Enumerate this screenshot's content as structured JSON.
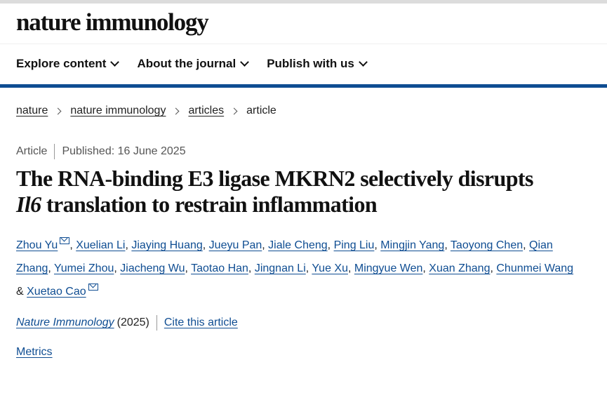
{
  "header": {
    "brand": "nature immunology"
  },
  "nav": {
    "items": [
      {
        "label": "Explore content"
      },
      {
        "label": "About the journal"
      },
      {
        "label": "Publish with us"
      }
    ]
  },
  "breadcrumb": {
    "items": [
      "nature",
      "nature immunology",
      "articles"
    ],
    "current": "article"
  },
  "article": {
    "type": "Article",
    "published": "Published: 16 June 2025",
    "title_part1": "The RNA-binding E3 ligase MKRN2 selectively disrupts",
    "title_italic": "Il6",
    "title_part2": "translation to restrain inflammation",
    "authors": [
      "Zhou Yu",
      "Xuelian Li",
      "Jiaying Huang",
      "Jueyu Pan",
      "Jiale Cheng",
      "Ping Liu",
      "Mingjin Yang",
      "Taoyong Chen",
      "Qian Zhang",
      "Yumei Zhou",
      "Jiacheng Wu",
      "Taotao Han",
      "Jingnan Li",
      "Yue Xu",
      "Mingyue Wen",
      "Xuan Zhang",
      "Chunmei Wang",
      "Xuetao Cao"
    ],
    "author_sep": ", ",
    "author_last_sep": " & ",
    "journal": "Nature Immunology",
    "year": "(2025)",
    "cite_label": "Cite this article",
    "metrics_label": "Metrics"
  },
  "colors": {
    "accent": "#0f4d92",
    "text": "#222222"
  },
  "icons": {
    "nav_chevron": "chevron-down-icon",
    "breadcrumb_sep": "chevron-right-icon",
    "corresponding": "mail-icon"
  }
}
